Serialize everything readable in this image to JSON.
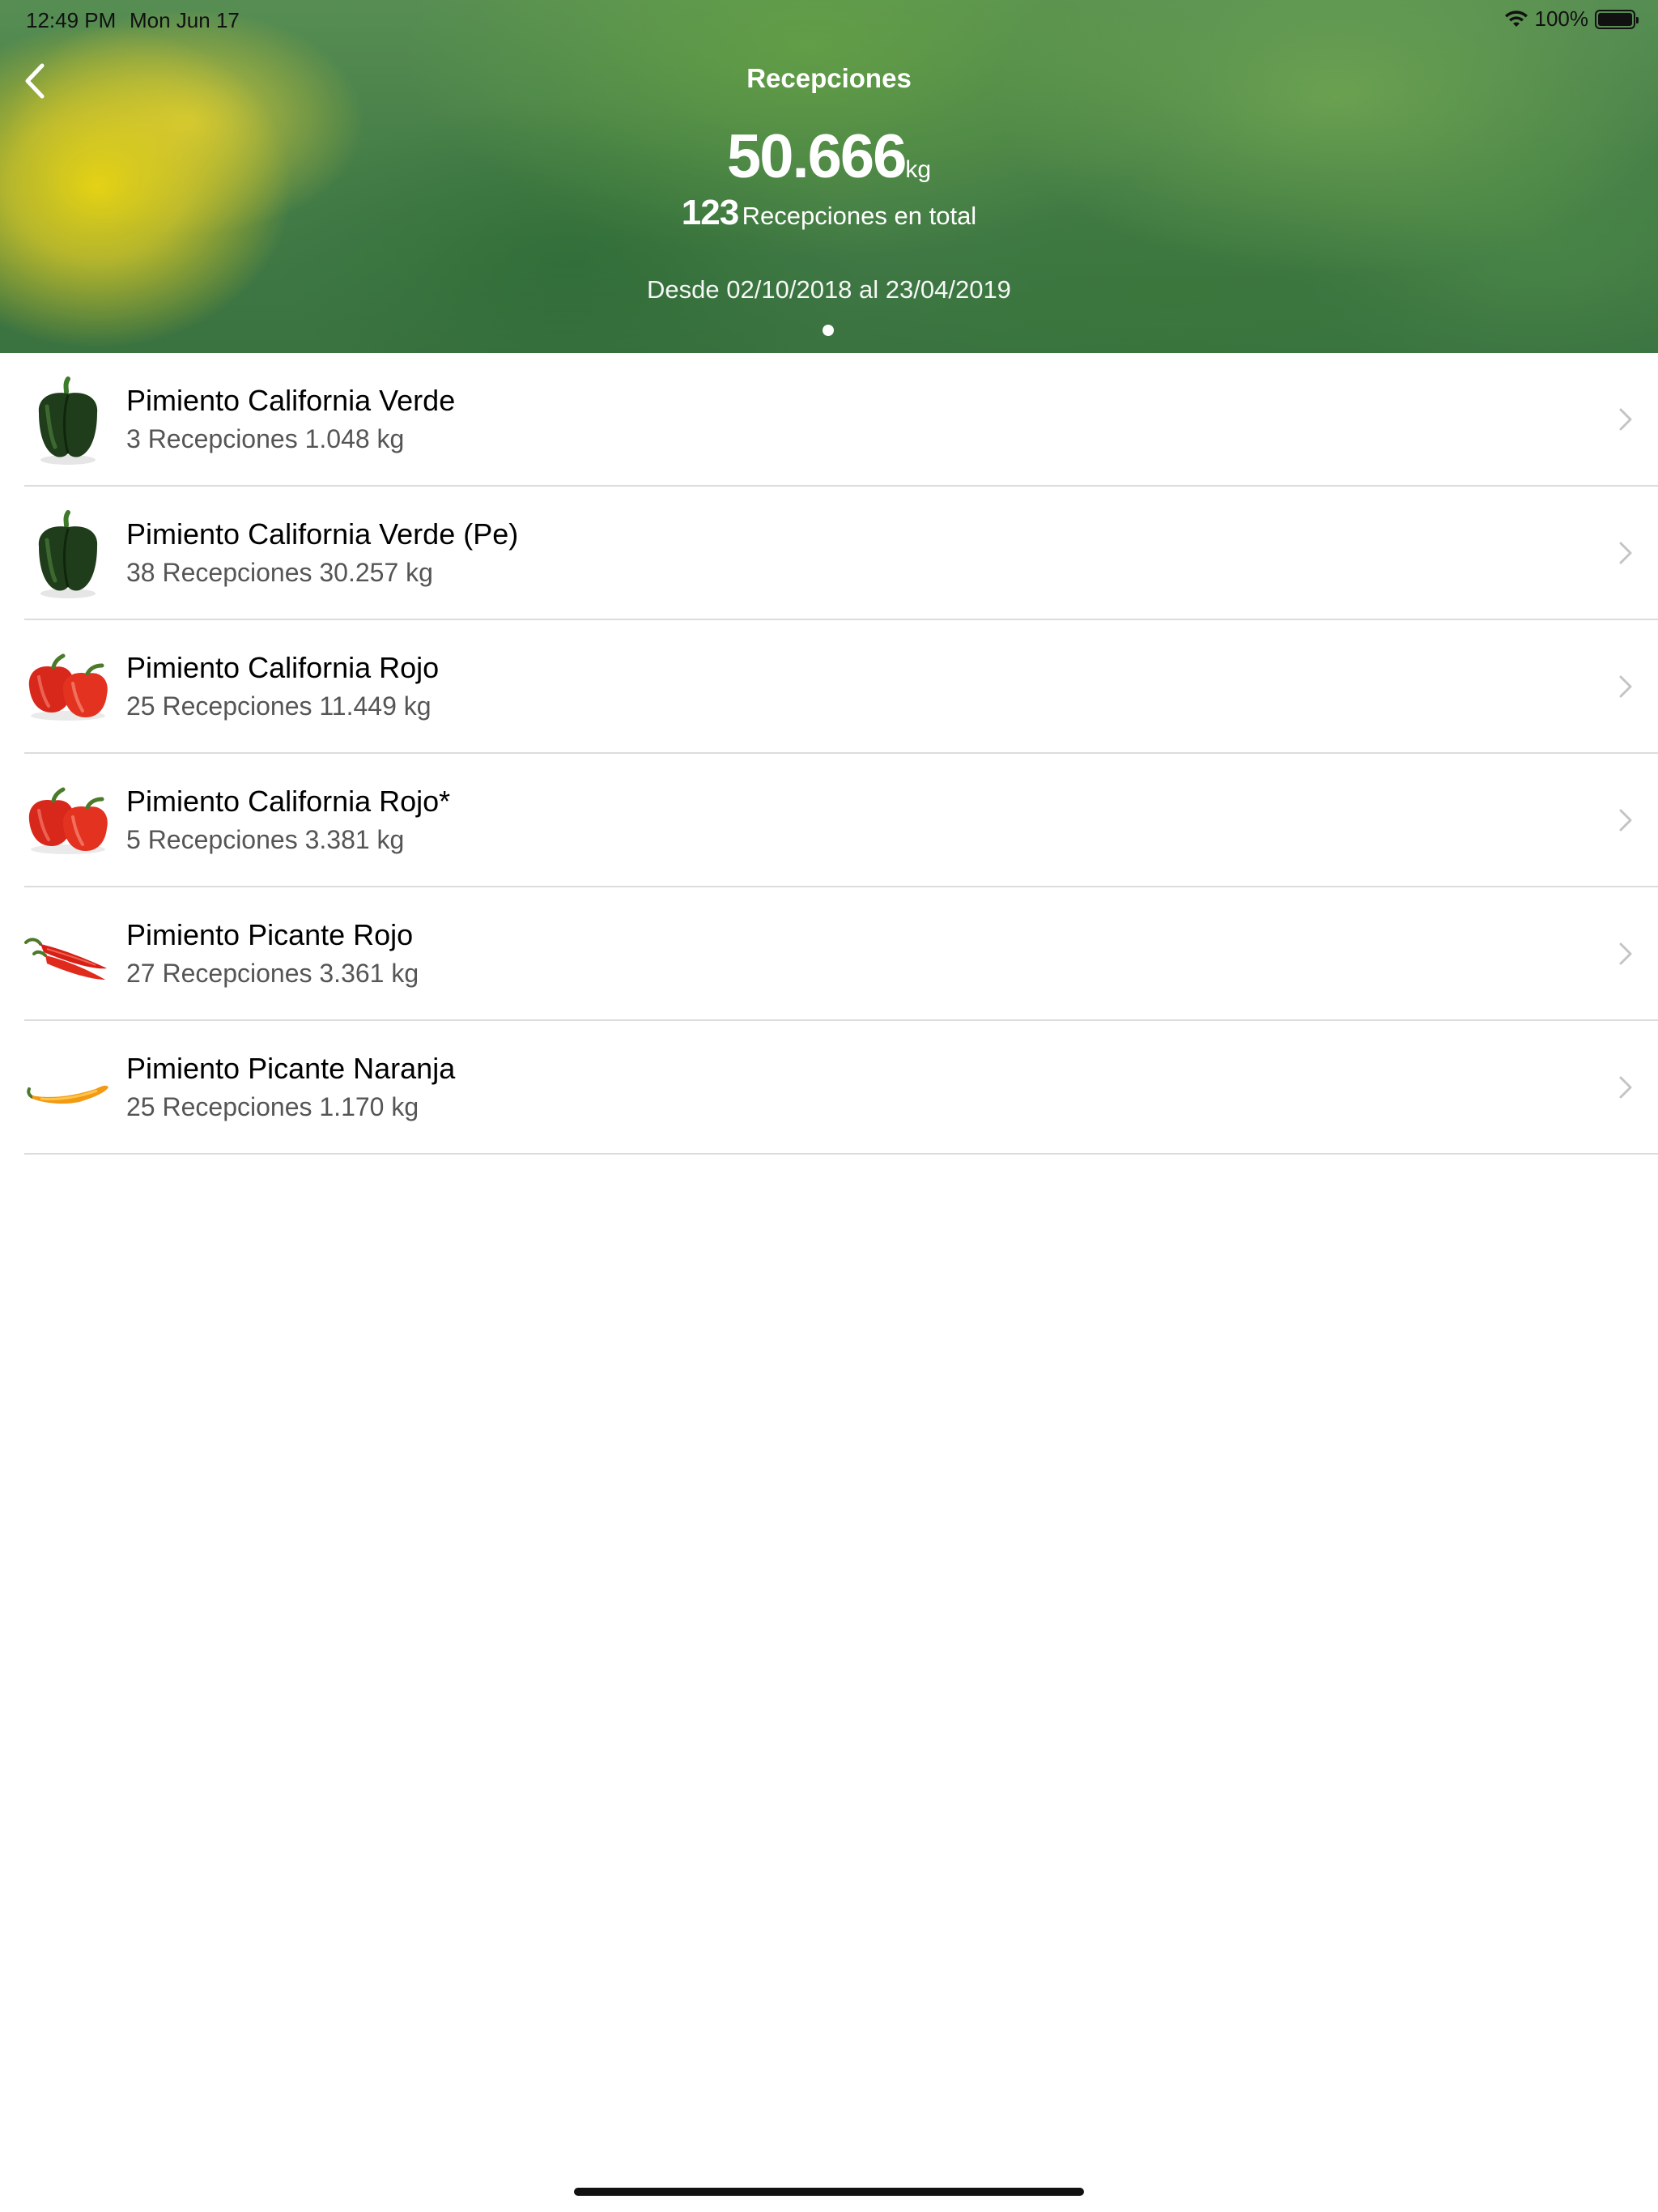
{
  "status_bar": {
    "time": "12:49 PM",
    "date": "Mon Jun 17",
    "battery": "100%",
    "icons": [
      "wifi-icon",
      "battery-icon"
    ]
  },
  "header": {
    "title": "Recepciones",
    "total_value": "50.666",
    "total_unit": "kg",
    "count_value": "123",
    "count_label": "Recepciones en total",
    "range": "Desde 02/10/2018 al 23/04/2019",
    "back_icon": "chevron-left-icon"
  },
  "items": [
    {
      "name": "Pimiento California Verde",
      "detail": "3 Recepciones 1.048 kg",
      "icon": "green-pepper-icon"
    },
    {
      "name": "Pimiento California Verde (Pe)",
      "detail": "38 Recepciones 30.257 kg",
      "icon": "green-pepper-icon"
    },
    {
      "name": "Pimiento California Rojo",
      "detail": "25 Recepciones 11.449 kg",
      "icon": "red-pepper-icon"
    },
    {
      "name": "Pimiento California Rojo*",
      "detail": "5 Recepciones 3.381 kg",
      "icon": "red-pepper-icon"
    },
    {
      "name": "Pimiento Picante Rojo",
      "detail": "27 Recepciones 3.361 kg",
      "icon": "red-chili-icon"
    },
    {
      "name": "Pimiento Picante Naranja",
      "detail": "25 Recepciones 1.170 kg",
      "icon": "orange-chili-icon"
    }
  ],
  "colors": {
    "header_green": "#4d8a4f",
    "separator": "#dcdcdc",
    "detail_text": "#555555",
    "chevron": "#c4c4c4"
  }
}
